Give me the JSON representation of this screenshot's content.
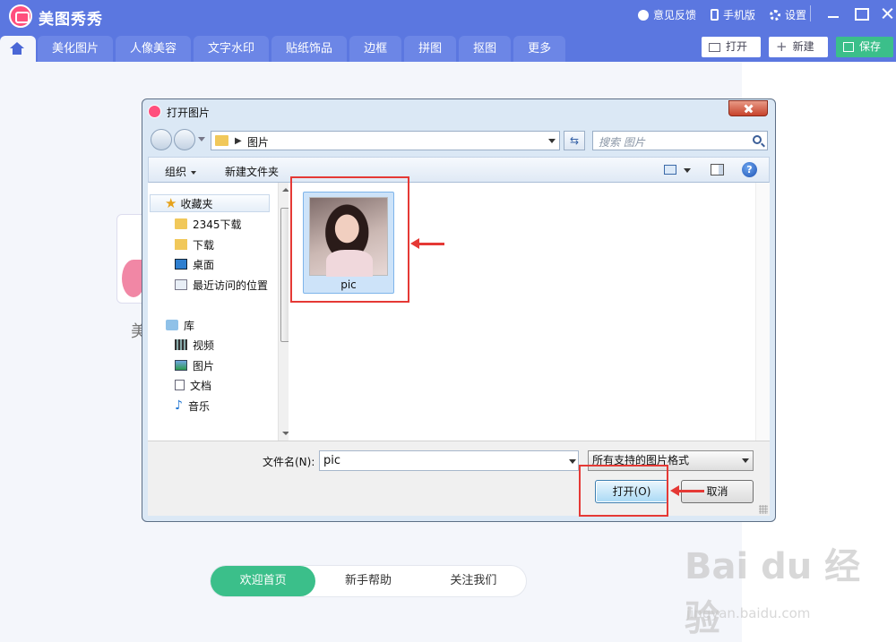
{
  "app": {
    "title": "美图秀秀",
    "top_actions": [
      {
        "label": "意见反馈",
        "icon": "feedback-icon"
      },
      {
        "label": "手机版",
        "icon": "phone-icon"
      },
      {
        "label": "设置",
        "icon": "gear-icon"
      }
    ],
    "tabs": [
      "美化图片",
      "人像美容",
      "文字水印",
      "贴纸饰品",
      "边框",
      "拼图",
      "抠图",
      "更多"
    ],
    "toolbar": {
      "open_label": "打开",
      "new_label": "新建",
      "save_label": "保存"
    },
    "background_text": "美",
    "bottom_tabs": [
      {
        "label": "欢迎首页",
        "active": true
      },
      {
        "label": "新手帮助",
        "active": false
      },
      {
        "label": "关注我们",
        "active": false
      }
    ],
    "colors": {
      "title_bar": "#5b77e0",
      "accent_green": "#3bbf8a"
    }
  },
  "watermark": {
    "main": "Bai du 经验",
    "sub": "jingyan.baidu.com"
  },
  "dialog": {
    "title": "打开图片",
    "address": "图片",
    "search_placeholder": "搜索 图片",
    "commands": {
      "organize": "组织",
      "new_folder": "新建文件夹"
    },
    "nav": {
      "favorites_label": "收藏夹",
      "favorites": [
        "2345下载",
        "下载",
        "桌面",
        "最近访问的位置"
      ],
      "libraries_label": "库",
      "libraries": [
        "视频",
        "图片",
        "文档",
        "音乐"
      ]
    },
    "files": [
      {
        "name": "pic"
      }
    ],
    "filename_label": "文件名(N):",
    "filename_value": "pic",
    "filetype_value": "所有支持的图片格式",
    "open_button": "打开(O)",
    "cancel_button": "取消"
  }
}
